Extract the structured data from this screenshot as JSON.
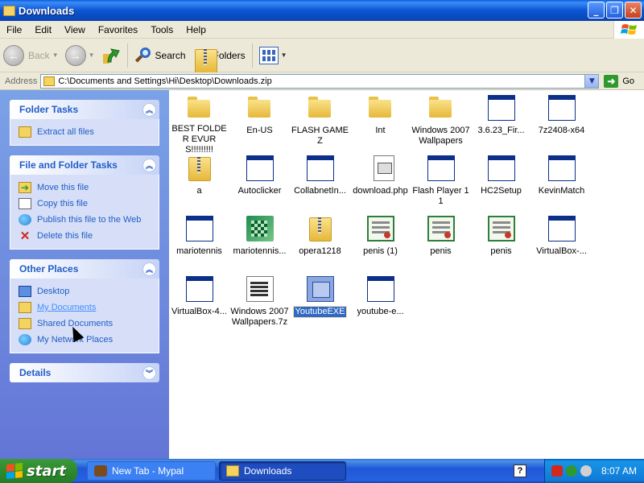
{
  "window": {
    "title": "Downloads"
  },
  "menu": [
    "File",
    "Edit",
    "View",
    "Favorites",
    "Tools",
    "Help"
  ],
  "toolbar": {
    "back_label": "Back",
    "search_label": "Search",
    "folders_label": "Folders"
  },
  "address": {
    "label": "Address",
    "value": "C:\\Documents and Settings\\Hi\\Desktop\\Downloads.zip",
    "go_label": "Go"
  },
  "panels": {
    "folder_tasks": {
      "title": "Folder Tasks",
      "items": [
        "Extract all files"
      ]
    },
    "file_tasks": {
      "title": "File and Folder Tasks",
      "items": [
        "Move this file",
        "Copy this file",
        "Publish this file to the Web",
        "Delete this file"
      ]
    },
    "other_places": {
      "title": "Other Places",
      "items": [
        "Desktop",
        "My Documents",
        "Shared Documents",
        "My Network Places"
      ]
    },
    "details": {
      "title": "Details"
    }
  },
  "files": [
    {
      "name": "BEST FOLDER EVURS!!!!!!!!!",
      "icon": "folder-icon"
    },
    {
      "name": "En-US",
      "icon": "folder-icon"
    },
    {
      "name": "FLASH GAMEZ",
      "icon": "folder-icon"
    },
    {
      "name": "Int",
      "icon": "folder-icon"
    },
    {
      "name": "Windows 2007 Wallpapers",
      "icon": "folder-icon"
    },
    {
      "name": "3.6.23_Fir...",
      "icon": "exe-icon"
    },
    {
      "name": "7z2408-x64",
      "icon": "exe-icon"
    },
    {
      "name": "a",
      "icon": "zip-folder-icon"
    },
    {
      "name": "Autoclicker",
      "icon": "exe-icon"
    },
    {
      "name": "CollabnetIn...",
      "icon": "exe-icon"
    },
    {
      "name": "download.php",
      "icon": "php-file-icon"
    },
    {
      "name": "Flash Player 11",
      "icon": "exe-icon"
    },
    {
      "name": "HC2Setup",
      "icon": "exe-icon"
    },
    {
      "name": "KevinMatch",
      "icon": "exe-icon"
    },
    {
      "name": "mariotennis",
      "icon": "exe-icon"
    },
    {
      "name": "mariotennis...",
      "icon": "installer-icon"
    },
    {
      "name": "opera1218",
      "icon": "zip-folder-icon"
    },
    {
      "name": "penis (1)",
      "icon": "certificate-icon"
    },
    {
      "name": "penis",
      "icon": "certificate-icon"
    },
    {
      "name": "penis",
      "icon": "certificate-icon"
    },
    {
      "name": "VirtualBox-...",
      "icon": "exe-icon"
    },
    {
      "name": "VirtualBox-4...",
      "icon": "exe-icon"
    },
    {
      "name": "Windows 2007 Wallpapers.7z",
      "icon": "archive-file-icon"
    },
    {
      "name": "YoutubeEXE",
      "icon": "exe-icon",
      "selected": true
    },
    {
      "name": "youtube-e...",
      "icon": "exe-icon"
    }
  ],
  "taskbar": {
    "start_label": "start",
    "tasks": [
      {
        "label": "New Tab - Mypal",
        "active": false
      },
      {
        "label": "Downloads",
        "active": true
      }
    ],
    "clock": "8:07 AM"
  },
  "colors": {
    "title_blue": "#0b55d4",
    "start_green": "#2d8b2d",
    "link_blue": "#215dc6",
    "selection": "#316ac5"
  }
}
